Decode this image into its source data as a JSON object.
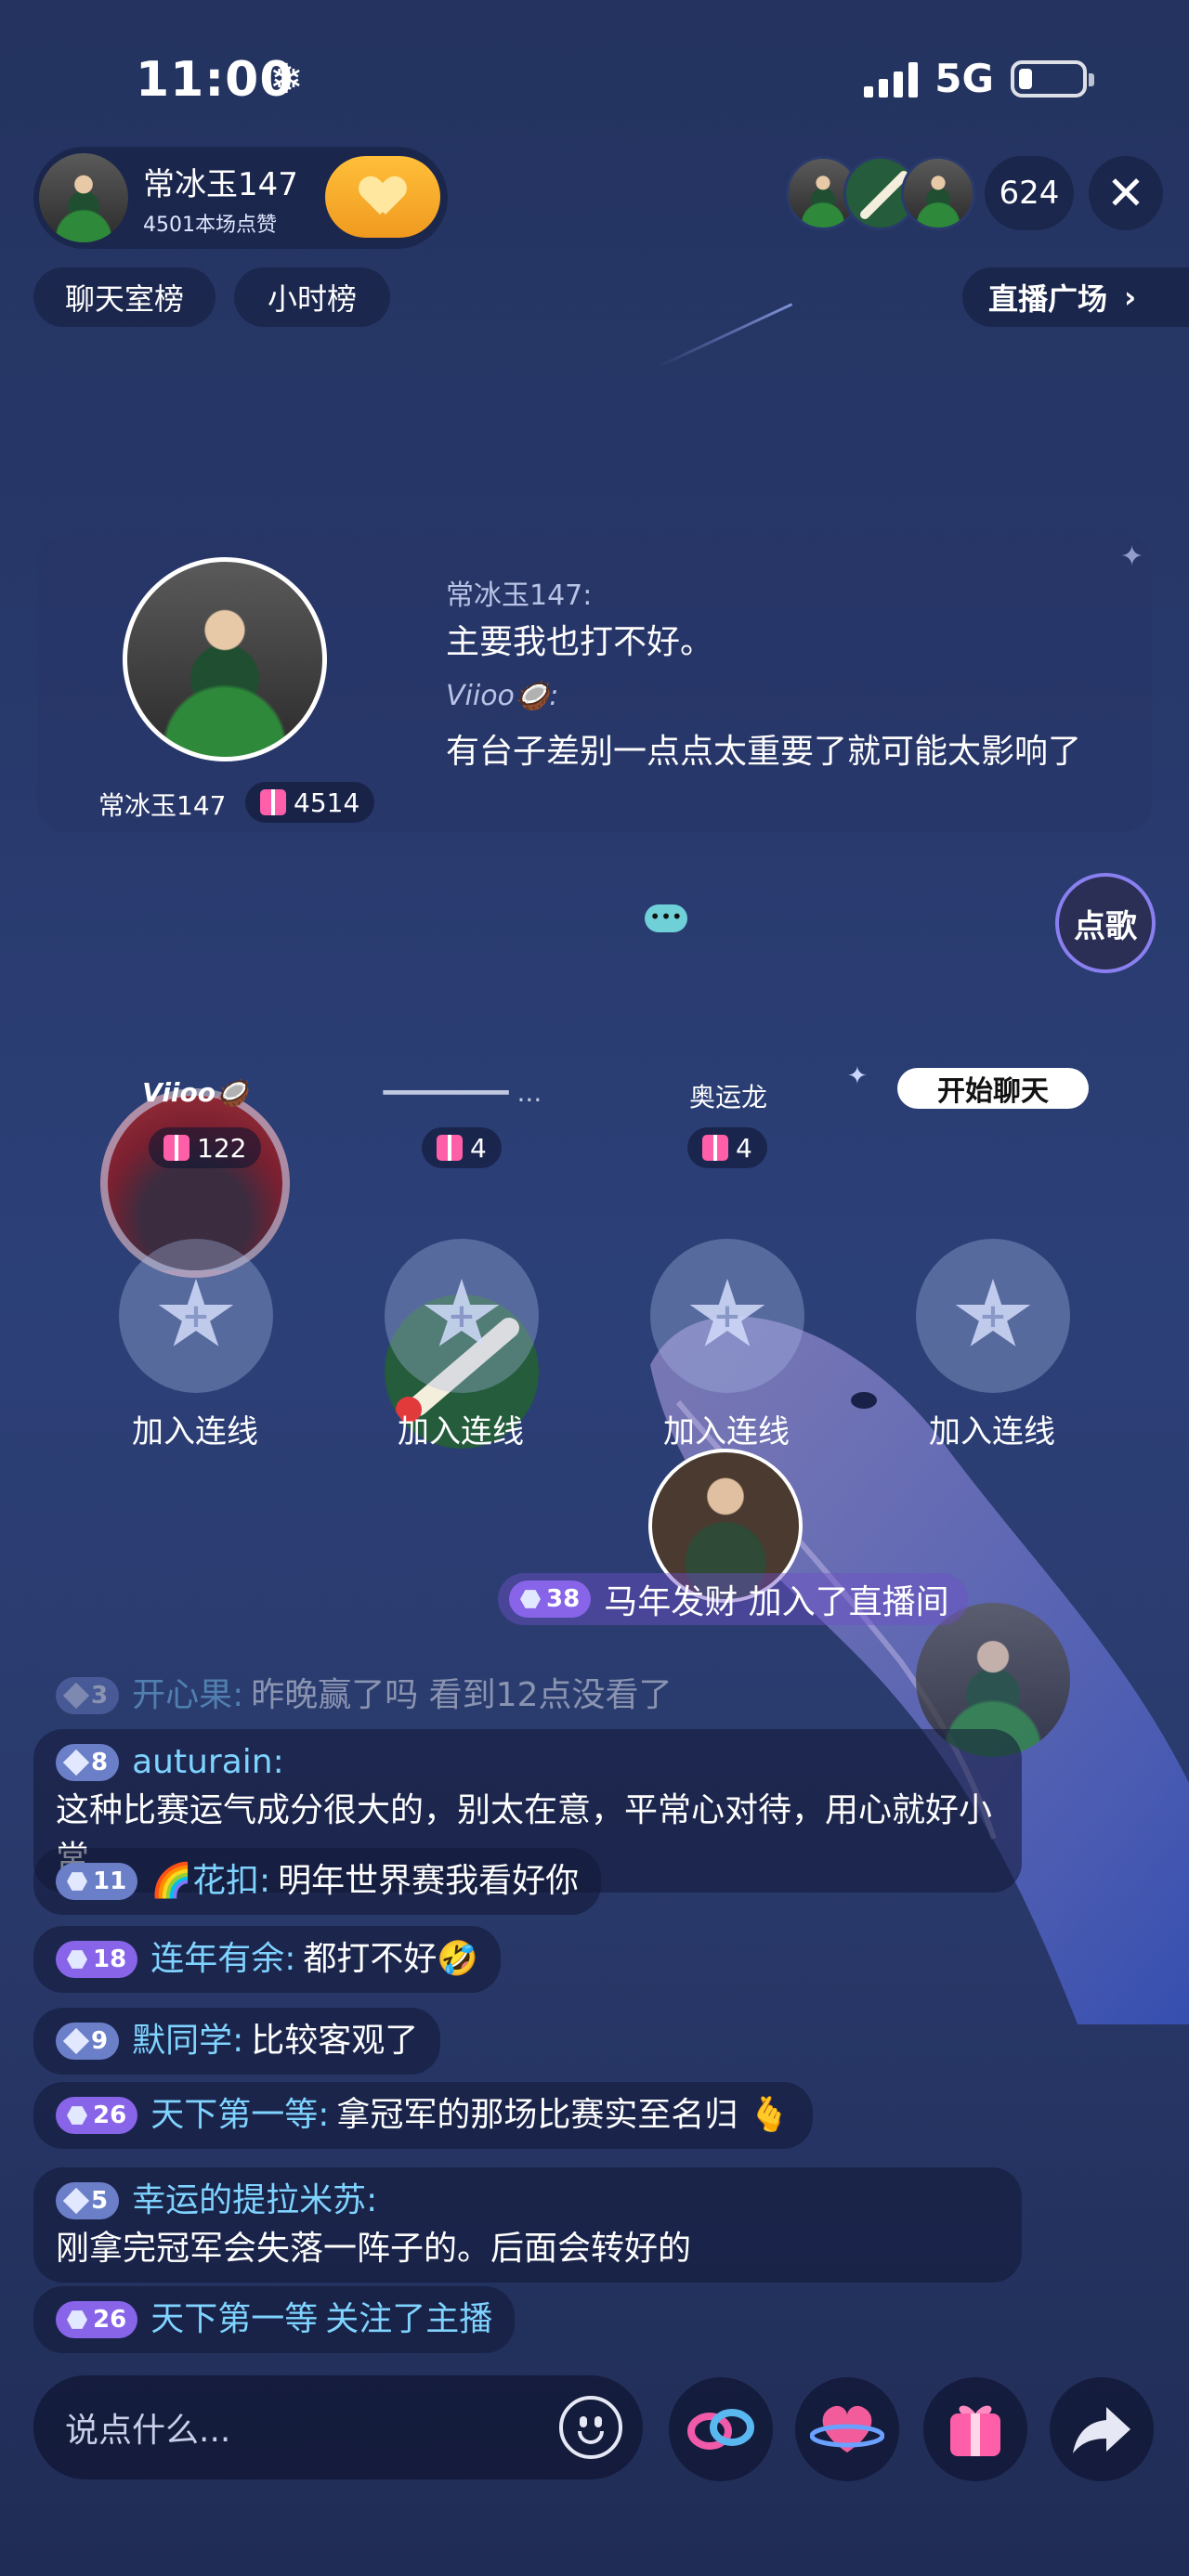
{
  "status": {
    "time": "11:00",
    "network": "5G"
  },
  "host": {
    "name": "常冰玉147",
    "likes": "4501本场点赞"
  },
  "viewer_count": "624",
  "ranks": {
    "chatroom": "聊天室榜",
    "hourly": "小时榜",
    "plaza": "直播广场"
  },
  "host_card": {
    "name": "常冰玉147",
    "gift_count": "4514",
    "messages": [
      {
        "from": "常冰玉147:",
        "text": "主要我也打不好。"
      },
      {
        "from": "Viioo🥥:",
        "text": "有台子差别一点点太重要了就可能太影响了"
      }
    ]
  },
  "seats": [
    {
      "name": "Viioo🥥",
      "gifts": "122"
    },
    {
      "name": "━━━━━━━━ ...",
      "gifts": "4"
    },
    {
      "name": "奥运龙",
      "gifts": "4"
    },
    {
      "name": "开始聊天"
    }
  ],
  "song_button": "点歌",
  "join_label": "加入连线",
  "system_join": {
    "level": "38",
    "text": "马年发财 加入了直播间"
  },
  "chat": [
    {
      "level": "3",
      "user": "开心果:",
      "text": "昨晚赢了吗 看到12点没看了",
      "faded": true
    },
    {
      "level": "8",
      "user": "auturain:",
      "text": "这种比赛运气成分很大的，别太在意，平常心对待，用心就好小常"
    },
    {
      "level": "11",
      "user": "🌈花扣:",
      "text": "明年世界赛我看好你"
    },
    {
      "level": "18",
      "user": "连年有余:",
      "text": "都打不好🤣"
    },
    {
      "level": "9",
      "user": "默同学:",
      "text": "比较客观了"
    },
    {
      "level": "26",
      "user": "天下第一等:",
      "text": "拿冠军的那场比赛实至名归 🫰"
    },
    {
      "level": "5",
      "user": "幸运的提拉米苏:",
      "text": "刚拿完冠军会失落一阵子的。后面会转好的"
    },
    {
      "level": "26",
      "user": "天下第一等",
      "text": "关注了主播"
    }
  ],
  "input": {
    "placeholder": "说点什么..."
  },
  "icons": [
    "emoji-icon",
    "link-icon",
    "heart-planet-icon",
    "gift-icon",
    "share-icon"
  ]
}
